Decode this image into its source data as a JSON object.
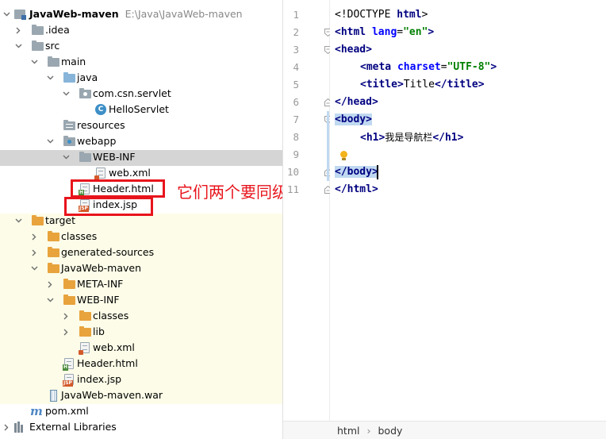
{
  "project_tree": {
    "rows": [
      {
        "label": "JavaWeb-maven",
        "path": "E:\\Java\\JavaWeb-maven"
      },
      {
        "label": ".idea"
      },
      {
        "label": "src"
      },
      {
        "label": "main"
      },
      {
        "label": "java"
      },
      {
        "label": "com.csn.servlet"
      },
      {
        "label": "HelloServlet"
      },
      {
        "label": "resources"
      },
      {
        "label": "webapp"
      },
      {
        "label": "WEB-INF"
      },
      {
        "label": "web.xml"
      },
      {
        "label": "Header.html"
      },
      {
        "label": "index.jsp"
      },
      {
        "label": "target"
      },
      {
        "label": "classes"
      },
      {
        "label": "generated-sources"
      },
      {
        "label": "JavaWeb-maven"
      },
      {
        "label": "META-INF"
      },
      {
        "label": "WEB-INF"
      },
      {
        "label": "classes"
      },
      {
        "label": "lib"
      },
      {
        "label": "web.xml"
      },
      {
        "label": "Header.html"
      },
      {
        "label": "index.jsp"
      },
      {
        "label": "JavaWeb-maven.war"
      },
      {
        "label": "pom.xml"
      },
      {
        "label": "External Libraries"
      }
    ],
    "icons": {
      "project": "module-folder-icon",
      "folder": "folder-icon",
      "source_root": "source-folder-icon",
      "resources_root": "resources-folder-icon",
      "web_root": "web-folder-icon",
      "excluded": "excluded-folder-icon",
      "java_class": "java-class-icon",
      "xml_file": "xml-file-icon",
      "html_file": "html-file-icon",
      "jsp_file": "jsp-file-icon",
      "war_file": "war-archive-icon",
      "maven_pom": "maven-icon",
      "libraries": "libraries-icon"
    }
  },
  "annotation": {
    "text": "它们两个要同级",
    "color": "#e8141c"
  },
  "editor": {
    "line_numbers": [
      "1",
      "2",
      "3",
      "4",
      "5",
      "6",
      "7",
      "8",
      "9",
      "10",
      "11"
    ],
    "lines": {
      "l1": {
        "lt": "<!DOCTYPE ",
        "kw": "html",
        "gt": ">"
      },
      "l2": {
        "open": "<html",
        "attr": " lang",
        "eq": "=",
        "val": "\"en\"",
        "close": ">"
      },
      "l3": {
        "text": "<head>"
      },
      "l4": {
        "open": "<meta",
        "attr": " charset",
        "eq": "=",
        "val": "\"UTF-8\"",
        "close": ">"
      },
      "l5": {
        "open": "<title>",
        "text": "Title",
        "close": "</title>"
      },
      "l6": {
        "text": "</head>"
      },
      "l7": {
        "text": "<body>"
      },
      "l8": {
        "open": "<h1>",
        "text": "我是导航栏",
        "close": "</h1>"
      },
      "l9": {
        "text": ""
      },
      "l10": {
        "text": "</body>"
      },
      "l11": {
        "text": "</html>"
      }
    },
    "current_line": 10
  },
  "breadcrumb": [
    "html",
    "body"
  ],
  "colors": {
    "tag": "#000080",
    "attribute": "#0000ff",
    "string": "#008000",
    "selection": "#c0d9f1",
    "caret_line": "#fcfae0",
    "excluded_bg": "#fcfce8"
  }
}
